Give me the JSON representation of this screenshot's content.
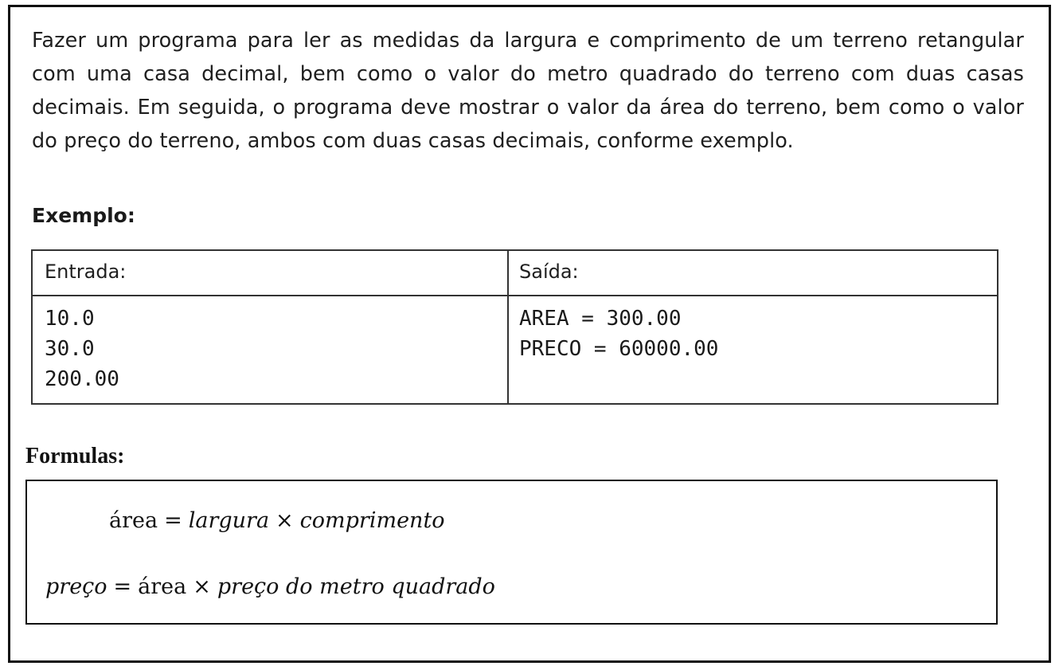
{
  "description": "Fazer um programa para ler as medidas da largura e comprimento de um terreno retangular com uma casa decimal, bem como o valor do metro quadrado do terreno com duas casas decimais. Em seguida, o programa deve mostrar o valor da área do terreno, bem como o valor do preço do terreno, ambos com duas casas decimais, conforme exemplo.",
  "example": {
    "title": "Exemplo:",
    "input_header": "Entrada:",
    "output_header": "Saída:",
    "input_lines": [
      "10.0",
      "30.0",
      "200.00"
    ],
    "output_lines": [
      "AREA = 300.00",
      "PRECO = 60000.00"
    ]
  },
  "formulas": {
    "title": "Formulas:",
    "area": {
      "lhs": "área",
      "eq": "=",
      "a": "largura",
      "times": "×",
      "b": "comprimento"
    },
    "price": {
      "lhs": "preço",
      "eq": "=",
      "a": "área",
      "times": "×",
      "b": "preço do metro quadrado"
    }
  }
}
